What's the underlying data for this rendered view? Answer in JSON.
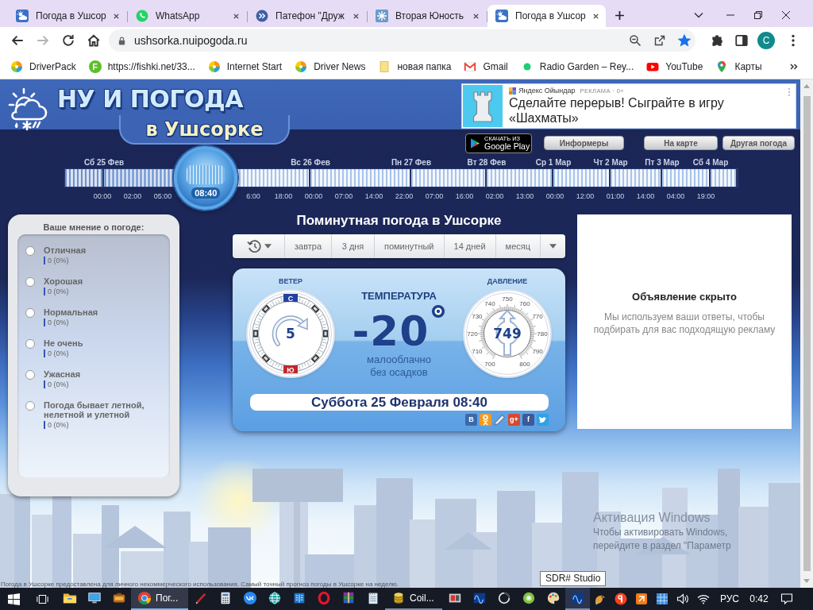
{
  "browser": {
    "tabs": [
      {
        "title": "Погода в Ушсор",
        "kind": "weather",
        "selected": false
      },
      {
        "title": "WhatsApp",
        "kind": "chat",
        "selected": false
      },
      {
        "title": "Патефон \"Друж",
        "kind": "forward",
        "selected": false
      },
      {
        "title": "Вторая Юность",
        "kind": "burst",
        "selected": false
      },
      {
        "title": "Погода в Ушсор",
        "kind": "weather",
        "selected": true
      }
    ],
    "nav_buttons": [
      {
        "kind": "back",
        "disabled": false
      },
      {
        "kind": "forward",
        "disabled": true
      },
      {
        "kind": "reload",
        "disabled": false
      },
      {
        "kind": "home",
        "disabled": false
      }
    ],
    "address": "ushsorka.nuipogoda.ru",
    "bookmarked": true,
    "profile_initial": "C",
    "bookmarks": [
      {
        "title": "DriverPack",
        "kind": "pinwheel"
      },
      {
        "title": "https://fishki.net/33...",
        "kind": "letter",
        "letter": "F"
      },
      {
        "title": "Internet Start",
        "kind": "pinwheel"
      },
      {
        "title": "Driver News",
        "kind": "pinwheel"
      },
      {
        "title": "новая папка",
        "kind": "folder"
      },
      {
        "title": "Gmail",
        "kind": "mail"
      },
      {
        "title": "Radio Garden – Rey...",
        "kind": "dot"
      },
      {
        "title": "YouTube",
        "kind": "play"
      },
      {
        "title": "Карты",
        "kind": "pin"
      }
    ]
  },
  "site": {
    "logo": {
      "title": "НУ И ПОГОДА",
      "subtitle": "в Ушсорке"
    },
    "top_ad": {
      "source": "Яндекс Ойындар",
      "label": "РЕКЛАМА · 0+",
      "headline": "Сделайте перерыв! Сыграйте в игру «Шахматы»"
    },
    "store_badge": {
      "caption": "СКАЧАТЬ ИЗ",
      "name": "Google Play"
    },
    "header_buttons": [
      "Информеры",
      "На карте",
      "Другая погода"
    ],
    "timeline": {
      "days": [
        "Сб 25 Фев",
        "Вс 26 Фев",
        "Пн 27 Фев",
        "Вт 28 Фев",
        "Ср 1 Мар",
        "Чт 2 Мар",
        "Пт 3 Мар",
        "Сб 4 Мар"
      ],
      "times": [
        "00:00",
        "02:00",
        "05:00",
        "6:00",
        "18:00",
        "00:00",
        "07:00",
        "14:00",
        "22:00",
        "07:00",
        "16:00",
        "02:00",
        "13:00",
        "00:00",
        "12:00",
        "01:00",
        "14:00",
        "04:00",
        "19:00"
      ],
      "current_time": "08:40",
      "level": 0.21
    },
    "poll": {
      "title": "Ваше мнение о погоде:",
      "options": [
        {
          "label": "Отличная",
          "result": "0 (0%)",
          "selected": false
        },
        {
          "label": "Хорошая",
          "result": "0 (0%)",
          "selected": false
        },
        {
          "label": "Нормальная",
          "result": "0 (0%)",
          "selected": false
        },
        {
          "label": "Не очень",
          "result": "0 (0%)",
          "selected": false
        },
        {
          "label": "Ужасная",
          "result": "0 (0%)",
          "selected": false
        },
        {
          "label": "Погода бывает летной, нелетной и улетной",
          "result": "0 (0%)",
          "selected": false
        }
      ]
    },
    "forecast": {
      "title": "Поминутная погода в Ушсорке",
      "tabs": [
        {
          "kind": "history",
          "selected": false
        },
        {
          "kind": "text",
          "label": "завтра",
          "selected": false
        },
        {
          "kind": "text",
          "label": "3 дня",
          "selected": false
        },
        {
          "kind": "text",
          "label": "поминутный",
          "selected": false
        },
        {
          "kind": "text",
          "label": "14 дней",
          "selected": false
        },
        {
          "kind": "text",
          "label": "месяц",
          "selected": false
        },
        {
          "kind": "more",
          "selected": false
        }
      ],
      "card": {
        "wind_label": "ВЕТЕР",
        "compass_north": "С",
        "compass_south": "Ю",
        "wind_speed": "5",
        "temperature_label": "ТЕМПЕРАТУРА",
        "temperature": "-20",
        "conditions": [
          "малооблачно",
          "без осадков"
        ],
        "pressure_label": "ДАВЛЕНИЕ",
        "pressure": "749",
        "pressure_scale": [
          "700",
          "710",
          "720",
          "730",
          "740",
          "750",
          "760",
          "770",
          "780",
          "790",
          "800"
        ],
        "datetime": "Суббота 25 Февраля 08:40",
        "share": [
          {
            "kind": "letter",
            "label": "В",
            "color": "#3b6aa8"
          },
          {
            "kind": "figure",
            "color": "#f29b1f"
          },
          {
            "kind": "pencil",
            "color": "#5b7fb5"
          },
          {
            "kind": "letter",
            "label": "g+",
            "color": "#d6492f"
          },
          {
            "kind": "letter",
            "label": "f",
            "color": "#3b5a9a"
          },
          {
            "kind": "bird",
            "color": "#2ea3e6"
          }
        ]
      }
    },
    "side_ad": {
      "title": "Объявление скрыто",
      "text": "Мы используем ваши ответы, чтобы подбирать для вас подходящую рекламу"
    },
    "footer": "Погода в Ушсорке предоставлена для личного некоммерческого использования. Самый точный прогноз погоды в Ушсорке на неделю."
  },
  "os_notice": {
    "title": "Активация Windows",
    "lines": [
      "Чтобы активировать Windows,",
      "перейдите в раздел \"Параметр"
    ]
  },
  "tooltip": "SDR# Studio",
  "taskbar": {
    "apps": [
      {
        "kind": "folder",
        "open": false,
        "selected": false,
        "hovered": false
      },
      {
        "kind": "monitor",
        "open": false,
        "selected": false,
        "hovered": false
      },
      {
        "kind": "box",
        "open": false,
        "selected": false,
        "hovered": false
      },
      {
        "kind": "browser",
        "label": "Пог...",
        "open": true,
        "selected": true,
        "hovered": false
      },
      {
        "kind": "pen",
        "open": false,
        "selected": false,
        "hovered": false
      },
      {
        "kind": "calculator",
        "open": false,
        "selected": false,
        "hovered": false
      },
      {
        "kind": "vk",
        "open": false,
        "selected": false,
        "hovered": false
      },
      {
        "kind": "globe",
        "open": false,
        "selected": false,
        "hovered": false
      },
      {
        "kind": "book",
        "open": false,
        "selected": false,
        "hovered": false
      },
      {
        "kind": "ring",
        "open": false,
        "selected": false,
        "hovered": false
      },
      {
        "kind": "archive",
        "open": false,
        "selected": false,
        "hovered": false
      },
      {
        "kind": "notepad",
        "open": false,
        "selected": false,
        "hovered": false
      },
      {
        "kind": "coins",
        "label": "Coil...",
        "open": true,
        "selected": false,
        "hovered": false
      },
      {
        "kind": "photo",
        "open": false,
        "selected": false,
        "hovered": false
      },
      {
        "kind": "wave",
        "open": false,
        "selected": false,
        "hovered": false
      },
      {
        "kind": "halfring",
        "open": false,
        "selected": false,
        "hovered": false
      },
      {
        "kind": "disc",
        "open": false,
        "selected": false,
        "hovered": false
      },
      {
        "kind": "palette",
        "open": false,
        "selected": false,
        "hovered": false
      },
      {
        "kind": "wave",
        "open": true,
        "selected": false,
        "hovered": true
      }
    ],
    "tray": [
      {
        "kind": "bird"
      },
      {
        "kind": "roundlogo"
      },
      {
        "kind": "tile"
      },
      {
        "kind": "grid"
      },
      {
        "kind": "volume"
      },
      {
        "kind": "wifi"
      }
    ],
    "language": "РУС",
    "clock": "0:42"
  }
}
